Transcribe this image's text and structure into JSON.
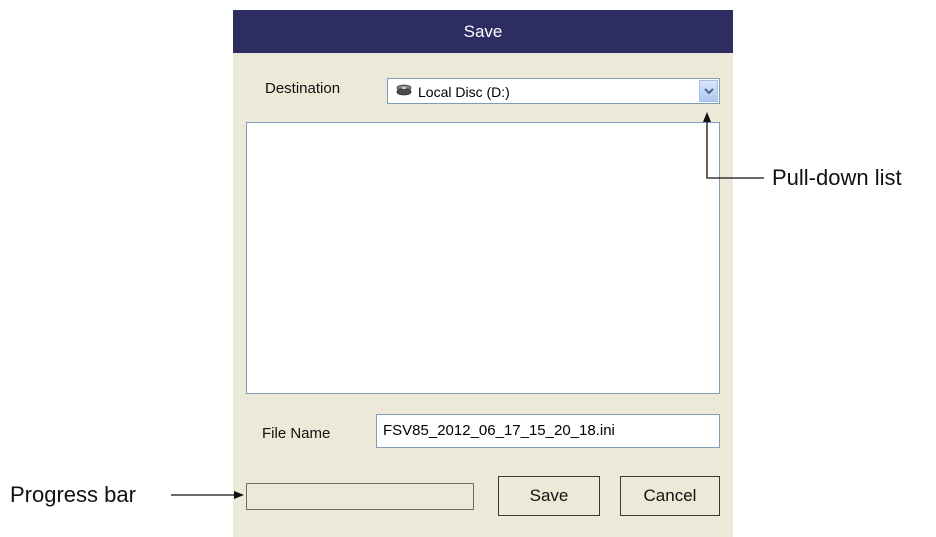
{
  "dialog": {
    "title": "Save",
    "destination_label": "Destination",
    "destination_value": "Local Disc (D:)",
    "destination_icon": "drive-icon",
    "file_name_label": "File Name",
    "file_name_value": "FSV85_2012_06_17_15_20_18.ini",
    "progress": 0,
    "save_label": "Save",
    "cancel_label": "Cancel"
  },
  "annotations": {
    "pulldown": "Pull-down list",
    "progress": "Progress bar"
  },
  "colors": {
    "titlebar": "#2d2d63",
    "dialog_bg": "#ece9d8",
    "field_border": "#7f9db9"
  }
}
